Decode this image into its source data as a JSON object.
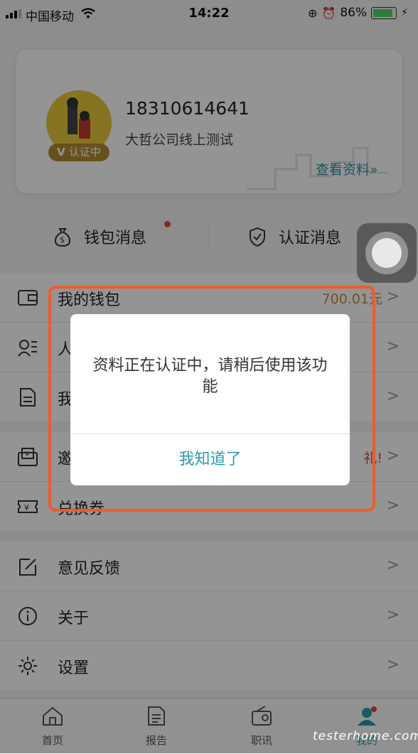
{
  "status_bar": {
    "carrier": "中国移动",
    "time": "14:22",
    "battery": "86%"
  },
  "profile": {
    "phone": "18310614641",
    "company": "大哲公司线上测试",
    "badge": "认证中",
    "view_more": "查看资料»"
  },
  "messages": {
    "wallet_msg": "钱包消息",
    "cert_msg": "认证消息"
  },
  "list": {
    "wallet": {
      "label": "我的钱包",
      "value": "700.01元"
    },
    "personal": {
      "label": "人"
    },
    "my": {
      "label": "我"
    },
    "invite": {
      "label": "邀",
      "value": "礼!"
    },
    "coupon": {
      "label": "兑换券"
    },
    "feedback": {
      "label": "意见反馈"
    },
    "about": {
      "label": "关于"
    },
    "settings": {
      "label": "设置"
    }
  },
  "chevron": ">",
  "tabs": [
    {
      "label": "首页",
      "icon": "home-icon"
    },
    {
      "label": "报告",
      "icon": "report-icon"
    },
    {
      "label": "职讯",
      "icon": "radio-icon"
    },
    {
      "label": "我的",
      "icon": "user-icon"
    }
  ],
  "dialog": {
    "message": "资料正在认证中，请稍后使用该功能",
    "confirm": "我知道了"
  },
  "watermark": "testerhome.com",
  "colors": {
    "accent": "#2d9aa8",
    "highlight": "#ee5b2c",
    "badge": "#b38a2e",
    "red_dot": "#e0463c"
  }
}
